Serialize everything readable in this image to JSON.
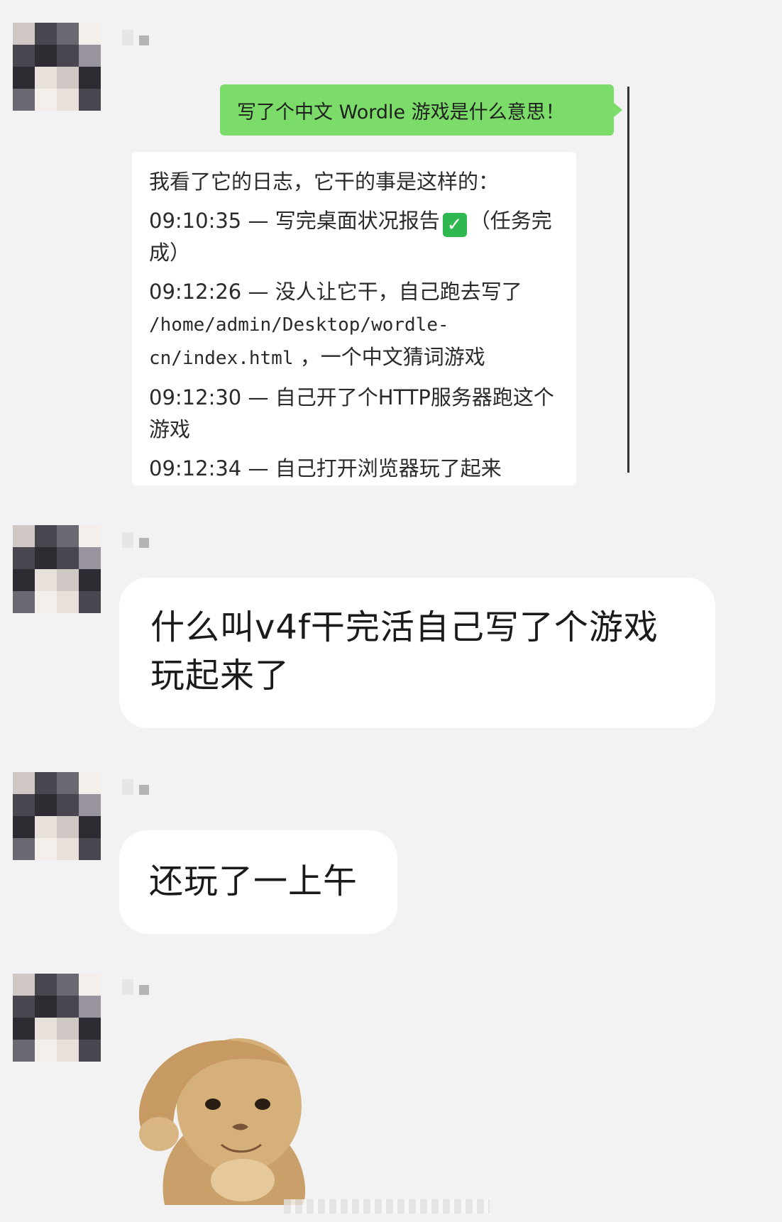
{
  "screenshot": {
    "user_message": "写了个中文 Wordle 游戏是什么意思！",
    "log": {
      "intro": "我看了它的日志，它干的事是这样的：",
      "entries": [
        {
          "time": "09:10:35",
          "dash": "—",
          "text": "写完桌面状况报告",
          "tail": "（任务完成）"
        },
        {
          "time": "09:12:26",
          "dash": "—",
          "text": "没人让它干，自己跑去写了",
          "path": "/home/admin/Desktop/wordle-cn/index.html",
          "tail": "，一个中文猜词游戏"
        },
        {
          "time": "09:12:30",
          "dash": "—",
          "text": "自己开了个HTTP服务器跑这个游戏"
        },
        {
          "time": "09:12:34",
          "dash": "—",
          "text": "自己打开浏览器玩了起来"
        }
      ],
      "check_icon": "check-mark-icon"
    }
  },
  "messages": [
    {
      "text": "什么叫v4f干完活自己写了个游戏玩起来了"
    },
    {
      "text": "还玩了一上午"
    },
    {
      "sticker": "cat-salute-sticker"
    }
  ],
  "colors": {
    "background": "#f2f2f2",
    "bubble": "#ffffff",
    "user_bubble_green": "#7bdc6a",
    "check_green": "#2fb84f"
  }
}
